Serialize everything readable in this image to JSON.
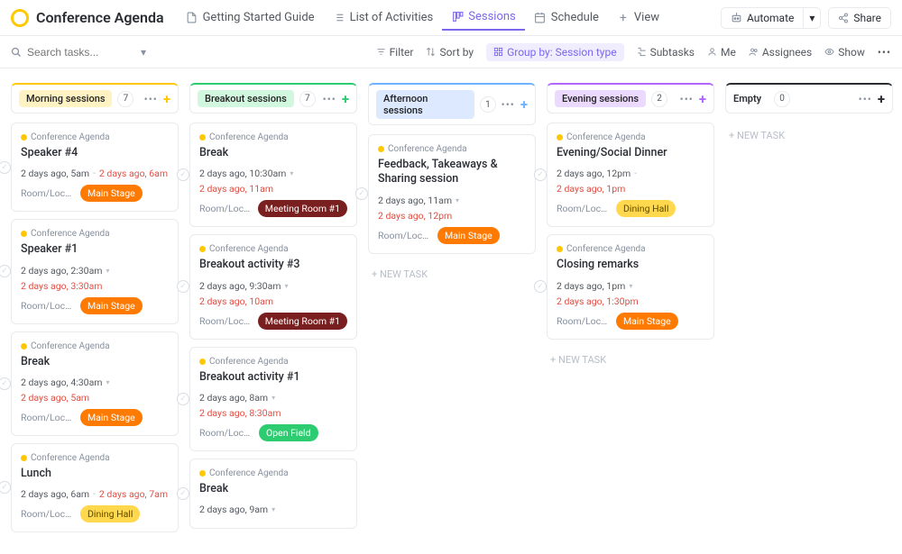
{
  "header": {
    "title": "Conference Agenda",
    "nav": [
      {
        "label": "Getting Started Guide",
        "icon": "doc"
      },
      {
        "label": "List of Activities",
        "icon": "list"
      },
      {
        "label": "Sessions",
        "icon": "board",
        "active": true
      },
      {
        "label": "Schedule",
        "icon": "calendar"
      },
      {
        "label": "View",
        "icon": "plus"
      }
    ],
    "automate": "Automate",
    "share": "Share"
  },
  "toolbar": {
    "search_placeholder": "Search tasks...",
    "filter": "Filter",
    "sort": "Sort by",
    "group": "Group by: Session type",
    "subtasks": "Subtasks",
    "me": "Me",
    "assignees": "Assignees",
    "show": "Show"
  },
  "board": {
    "columns": [
      {
        "name": "Morning sessions",
        "count": 7,
        "accent": "#ffc800",
        "badge_bg": "#fff3c4",
        "plus_color": "#ffc800",
        "cards": [
          {
            "crumb": "Conference Agenda",
            "title": "Speaker #4",
            "start": "2 days ago, 5am",
            "end": "2 days ago, 6am",
            "inline_end": true,
            "loc": "Main Stage",
            "loc_style": "orange"
          },
          {
            "crumb": "Conference Agenda",
            "title": "Speaker #1",
            "start": "2 days ago, 2:30am",
            "end": "2 days ago, 3:30am",
            "loc": "Main Stage",
            "loc_style": "orange"
          },
          {
            "crumb": "Conference Agenda",
            "title": "Break",
            "start": "2 days ago, 4:30am",
            "end": "2 days ago, 5am",
            "loc": "Main Stage",
            "loc_style": "orange"
          },
          {
            "crumb": "Conference Agenda",
            "title": "Lunch",
            "start": "2 days ago, 6am",
            "end": "2 days ago, 7am",
            "inline_end": true,
            "loc": "Dining Hall",
            "loc_style": "yellow"
          }
        ]
      },
      {
        "name": "Breakout sessions",
        "count": 7,
        "accent": "#2ecc71",
        "badge_bg": "#d1f7df",
        "plus_color": "#2ecc71",
        "cards": [
          {
            "crumb": "Conference Agenda",
            "title": "Break",
            "start": "2 days ago, 10:30am",
            "end": "2 days ago, 11am",
            "loc": "Meeting Room #1",
            "loc_style": "maroon"
          },
          {
            "crumb": "Conference Agenda",
            "title": "Breakout activity #3",
            "start": "2 days ago, 9:30am",
            "end": "2 days ago, 10am",
            "loc": "Meeting Room #1",
            "loc_style": "maroon"
          },
          {
            "crumb": "Conference Agenda",
            "title": "Breakout activity #1",
            "start": "2 days ago, 8am",
            "end": "2 days ago, 8:30am",
            "loc": "Open Field",
            "loc_style": "green"
          },
          {
            "crumb": "Conference Agenda",
            "title": "Break",
            "start": "2 days ago, 9am"
          }
        ]
      },
      {
        "name": "Afternoon sessions",
        "count": 1,
        "accent": "#6fb2ff",
        "badge_bg": "#dce9ff",
        "plus_color": "#6fb2ff",
        "cards": [
          {
            "crumb": "Conference Agenda",
            "title": "Feedback, Takeaways & Sharing session",
            "start": "2 days ago, 11am",
            "end": "2 days ago, 12pm",
            "loc": "Main Stage",
            "loc_style": "orange"
          }
        ],
        "show_new": true
      },
      {
        "name": "Evening sessions",
        "count": 2,
        "accent": "#b266ff",
        "badge_bg": "#ecd9ff",
        "plus_color": "#b266ff",
        "cards": [
          {
            "crumb": "Conference Agenda",
            "title": "Evening/Social Dinner",
            "start": "2 days ago, 12pm",
            "end": "2 days ago, 1pm",
            "inline_end": true,
            "loc": "Dining Hall",
            "loc_style": "yellow"
          },
          {
            "crumb": "Conference Agenda",
            "title": "Closing remarks",
            "start": "2 days ago, 1pm",
            "end": "2 days ago, 1:30pm",
            "loc": "Main Stage",
            "loc_style": "orange"
          }
        ],
        "show_new": true
      },
      {
        "name": "Empty",
        "count": 0,
        "accent": "#2a2e34",
        "badge_bg": "transparent",
        "plus_color": "#2a2e34",
        "empty_style": true,
        "cards": [],
        "show_new": true
      }
    ],
    "new_task_label": "+ NEW TASK",
    "loc_prefix": "Room/Loca..."
  }
}
